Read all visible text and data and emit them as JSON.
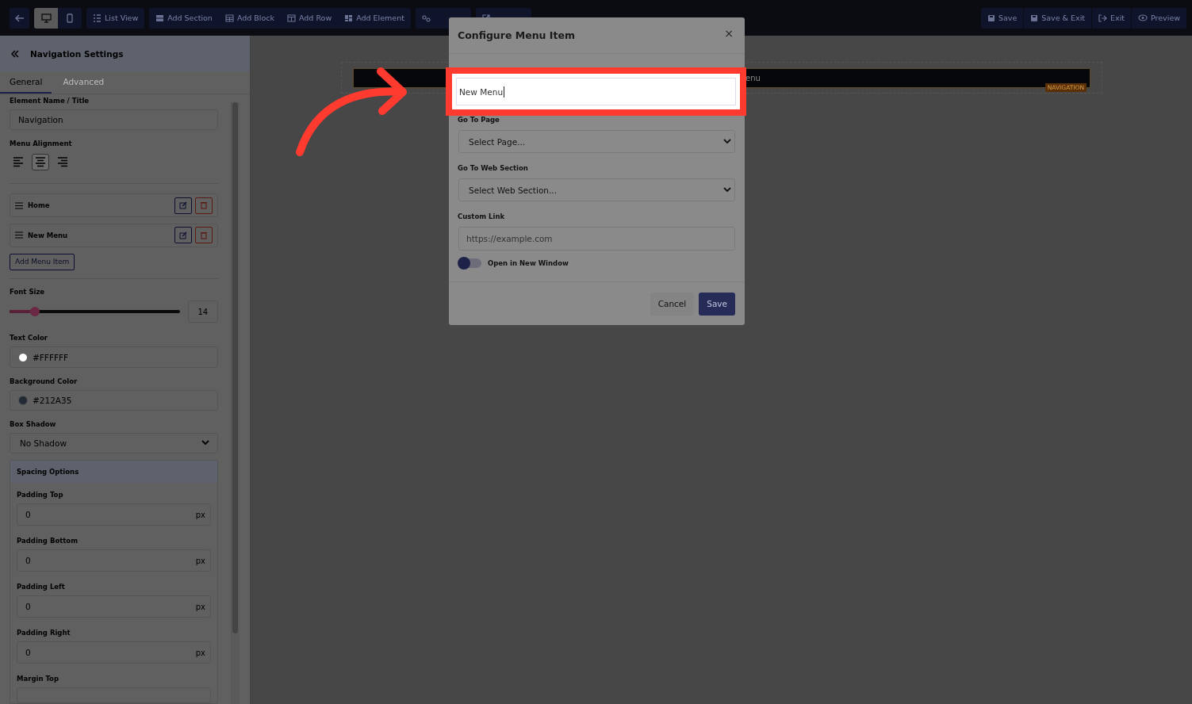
{
  "toolbar": {
    "devices": [
      {
        "kind": "desktop",
        "selected": true
      },
      {
        "kind": "mobile",
        "selected": false
      }
    ],
    "left_buttons": [
      {
        "label": "List View",
        "kind": "list"
      },
      {
        "label": "Add Section",
        "kind": "section"
      },
      {
        "label": "Add Block",
        "kind": "block"
      },
      {
        "label": "Add Row",
        "kind": "row"
      },
      {
        "label": "Add Element",
        "kind": "element"
      },
      {
        "kind": "settings"
      },
      {
        "kind": "popup"
      }
    ],
    "right_buttons": [
      {
        "label": "Save",
        "kind": "save"
      },
      {
        "label": "Save & Exit",
        "kind": "saveexit"
      },
      {
        "label": "Exit",
        "kind": "exit"
      },
      {
        "label": "Preview",
        "kind": "preview"
      }
    ]
  },
  "sidebar": {
    "title": "Navigation Settings",
    "tabs": [
      {
        "label": "General",
        "selected": true
      },
      {
        "label": "Advanced",
        "selected": false
      }
    ],
    "element_name": {
      "label": "Element Name / Title",
      "value": "Navigation"
    },
    "alignment": {
      "label": "Menu Alignment",
      "options": [
        {
          "kind": "left",
          "selected": false
        },
        {
          "kind": "center",
          "selected": true
        },
        {
          "kind": "right",
          "selected": false
        }
      ]
    },
    "menu_items": [
      {
        "label": "Home"
      },
      {
        "label": "New Menu"
      }
    ],
    "add_button": "Add Menu Item",
    "font_size": {
      "label": "Font Size",
      "level": 0.15,
      "value": "14"
    },
    "text_color": {
      "label": "Text Color",
      "value": "#FFFFFF",
      "color": "#ffffff"
    },
    "background_color": {
      "label": "Background Color",
      "value": "#212A35",
      "color": "#212a35"
    },
    "box_shadow": {
      "label": "Box Shadow",
      "value": "No Shadow"
    },
    "spacing": {
      "title": "Spacing Options",
      "fields": [
        {
          "label": "Padding Top",
          "value": "0",
          "unit": "px"
        },
        {
          "label": "Padding Bottom",
          "value": "0",
          "unit": "px"
        },
        {
          "label": "Padding Left",
          "value": "0",
          "unit": "px"
        },
        {
          "label": "Padding Right",
          "value": "0",
          "unit": "px"
        }
      ],
      "last_label": "Margin Top"
    }
  },
  "canvas": {
    "nav_text": "enu",
    "badge": "NAVIGATION"
  },
  "modal": {
    "title": "Configure Menu Item",
    "close": "×",
    "name_value": "New Menu",
    "page": {
      "label": "Go To Page",
      "value": "Select Page..."
    },
    "section": {
      "label": "Go To Web Section",
      "value": "Select Web Section..."
    },
    "link": {
      "label": "Custom Link",
      "placeholder": "https://example.com"
    },
    "new_window": {
      "label": "Open in New Window",
      "on": false
    },
    "buttons": [
      {
        "label": "Cancel",
        "kind": "secondary"
      },
      {
        "label": "Save",
        "kind": "primary"
      }
    ]
  }
}
